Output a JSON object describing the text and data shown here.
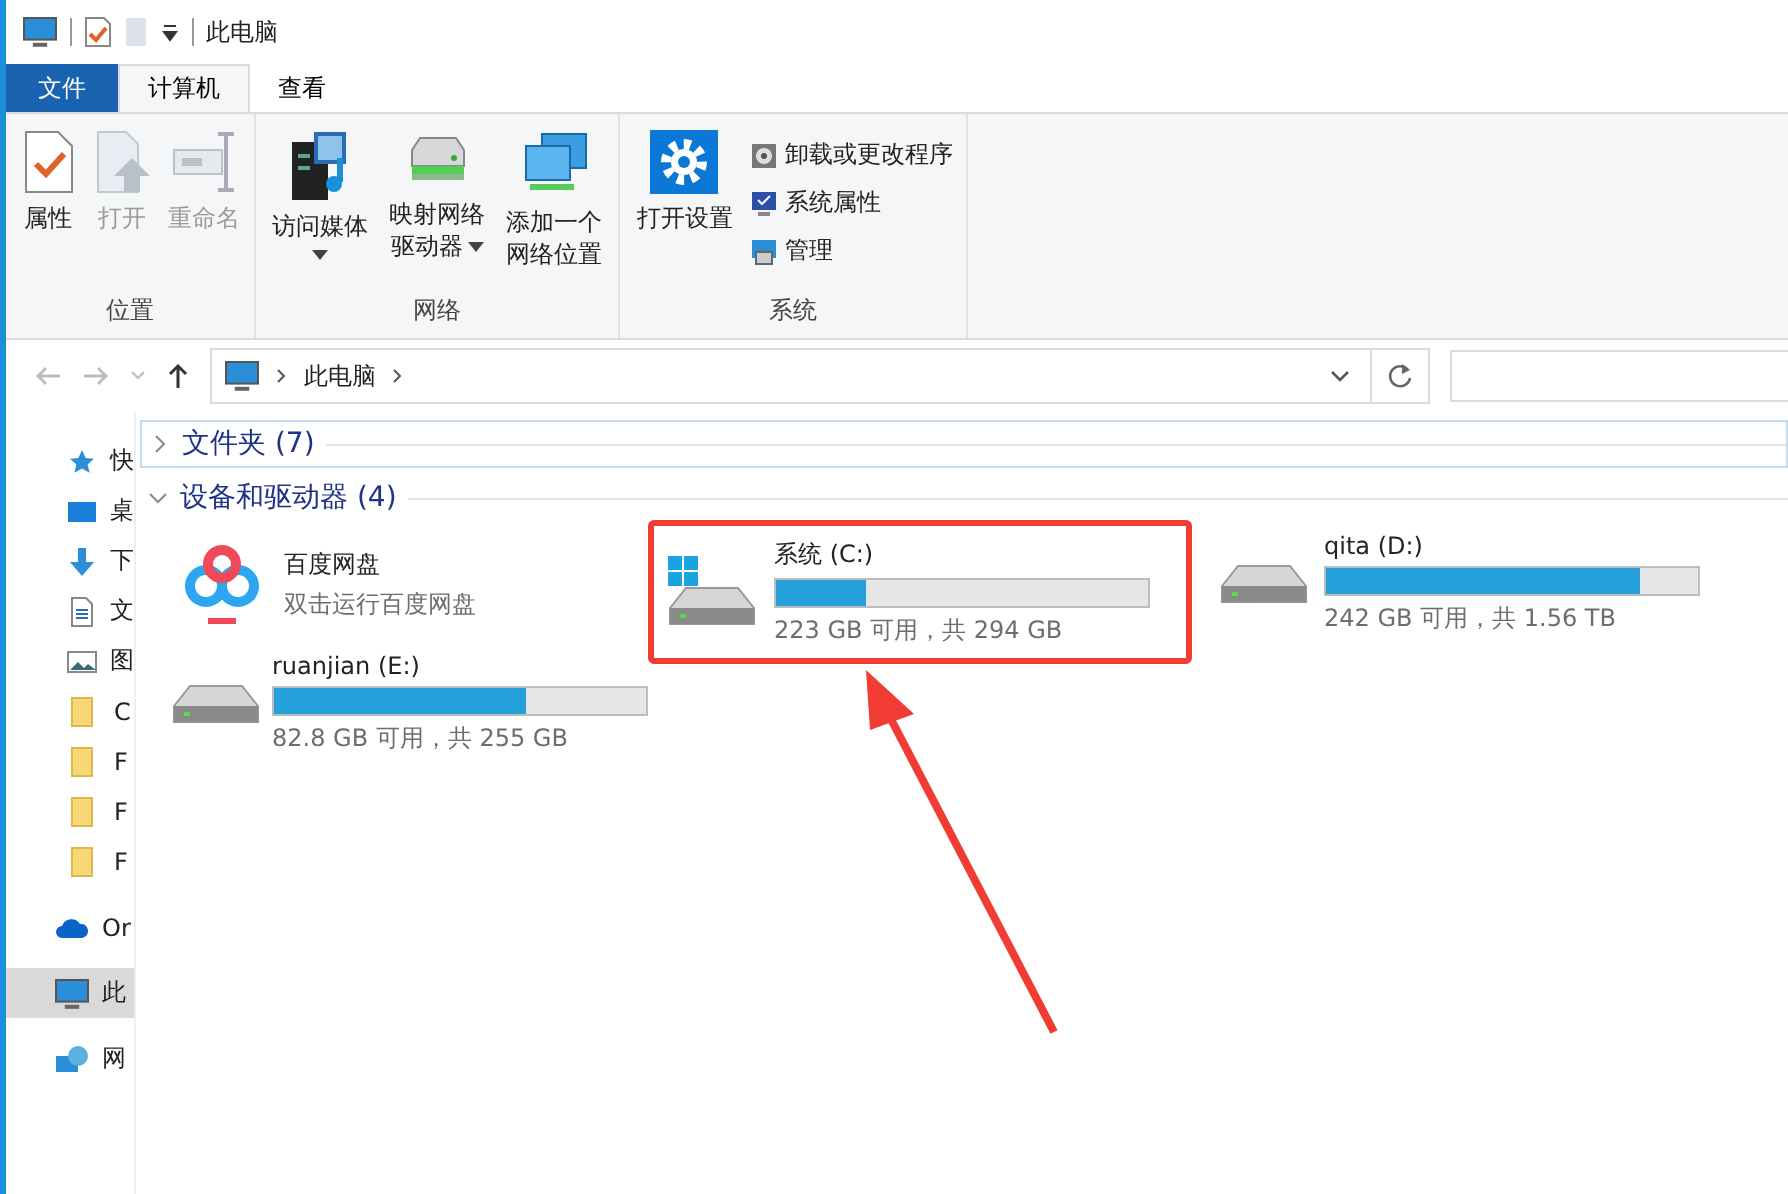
{
  "window": {
    "title": "此电脑"
  },
  "tabs": [
    {
      "label": "文件",
      "kind": "file",
      "selected": false
    },
    {
      "label": "计算机",
      "kind": "tab",
      "selected": true
    },
    {
      "label": "查看",
      "kind": "tab",
      "selected": false
    }
  ],
  "ribbon": {
    "groups": [
      {
        "label": "位置",
        "items": [
          {
            "label": "属性",
            "disabled": false
          },
          {
            "label": "打开",
            "disabled": true
          },
          {
            "label": "重命名",
            "disabled": true
          }
        ]
      },
      {
        "label": "网络",
        "items": [
          {
            "label": "访问媒体",
            "disabled": false
          },
          {
            "label": "映射网络驱动器",
            "disabled": false
          },
          {
            "label": "添加一个网络位置",
            "disabled": false
          }
        ]
      },
      {
        "label": "系统",
        "items": [
          {
            "label": "打开设置",
            "disabled": false
          }
        ],
        "small_items": [
          {
            "label": "卸载或更改程序"
          },
          {
            "label": "系统属性"
          },
          {
            "label": "管理"
          }
        ]
      }
    ]
  },
  "address": {
    "path": "此电脑"
  },
  "navigation": [
    {
      "label": "快",
      "selected": false
    },
    {
      "label": "桌",
      "selected": false
    },
    {
      "label": "下",
      "selected": false
    },
    {
      "label": "文",
      "selected": false
    },
    {
      "label": "图",
      "selected": false
    },
    {
      "label": "C",
      "selected": false
    },
    {
      "label": "F",
      "selected": false
    },
    {
      "label": "F",
      "selected": false
    },
    {
      "label": "F",
      "selected": false
    },
    {
      "label": "Or",
      "selected": false
    },
    {
      "label": "此",
      "selected": true
    },
    {
      "label": "网",
      "selected": false
    }
  ],
  "sections": [
    {
      "label": "文件夹 (7)",
      "expanded": false
    },
    {
      "label": "设备和驱动器 (4)",
      "expanded": true
    }
  ],
  "drives": [
    {
      "kind": "app",
      "name": "百度网盘",
      "detail": "双击运行百度网盘",
      "highlighted": false
    },
    {
      "kind": "drive",
      "name": "系统 (C:)",
      "system": true,
      "level": 0.24,
      "detail": "223 GB 可用，共 294 GB",
      "highlighted": true
    },
    {
      "kind": "drive",
      "name": "qita (D:)",
      "system": false,
      "level": 0.845,
      "detail": "242 GB 可用，共 1.56 TB",
      "highlighted": false
    },
    {
      "kind": "drive",
      "name": "ruanjian (E:)",
      "system": false,
      "level": 0.675,
      "detail": "82.8 GB 可用，共 255 GB",
      "highlighted": false
    }
  ]
}
